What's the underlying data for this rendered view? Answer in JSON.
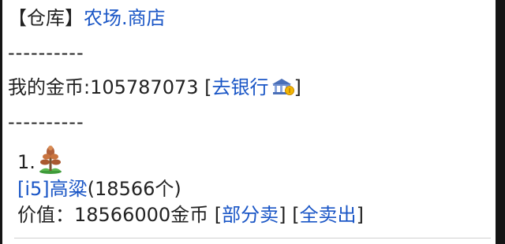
{
  "header": {
    "bracket_title": "【仓库】",
    "link_farm_shop": "农场.商店"
  },
  "divider_1": "----------",
  "gold": {
    "label": "我的金币:105787073",
    "open_bracket": "[",
    "bank_link": "去银行",
    "bank_icon": "bank-icon",
    "close_bracket": "]"
  },
  "divider_2": "----------",
  "item": {
    "index": "1.",
    "icon": "sorghum-plant-icon",
    "level_link": "[i5]",
    "name_link": "高粱",
    "quantity": "(18566个)",
    "value_label": "价值：18566000金币",
    "sell_part_open": "[",
    "sell_part_link": "部分卖",
    "sell_part_close": "]",
    "sell_all_open": "[",
    "sell_all_link": "全卖出",
    "sell_all_close": "]"
  },
  "colors": {
    "link": "#1a56c6",
    "text": "#222222",
    "frame": "#151515"
  }
}
